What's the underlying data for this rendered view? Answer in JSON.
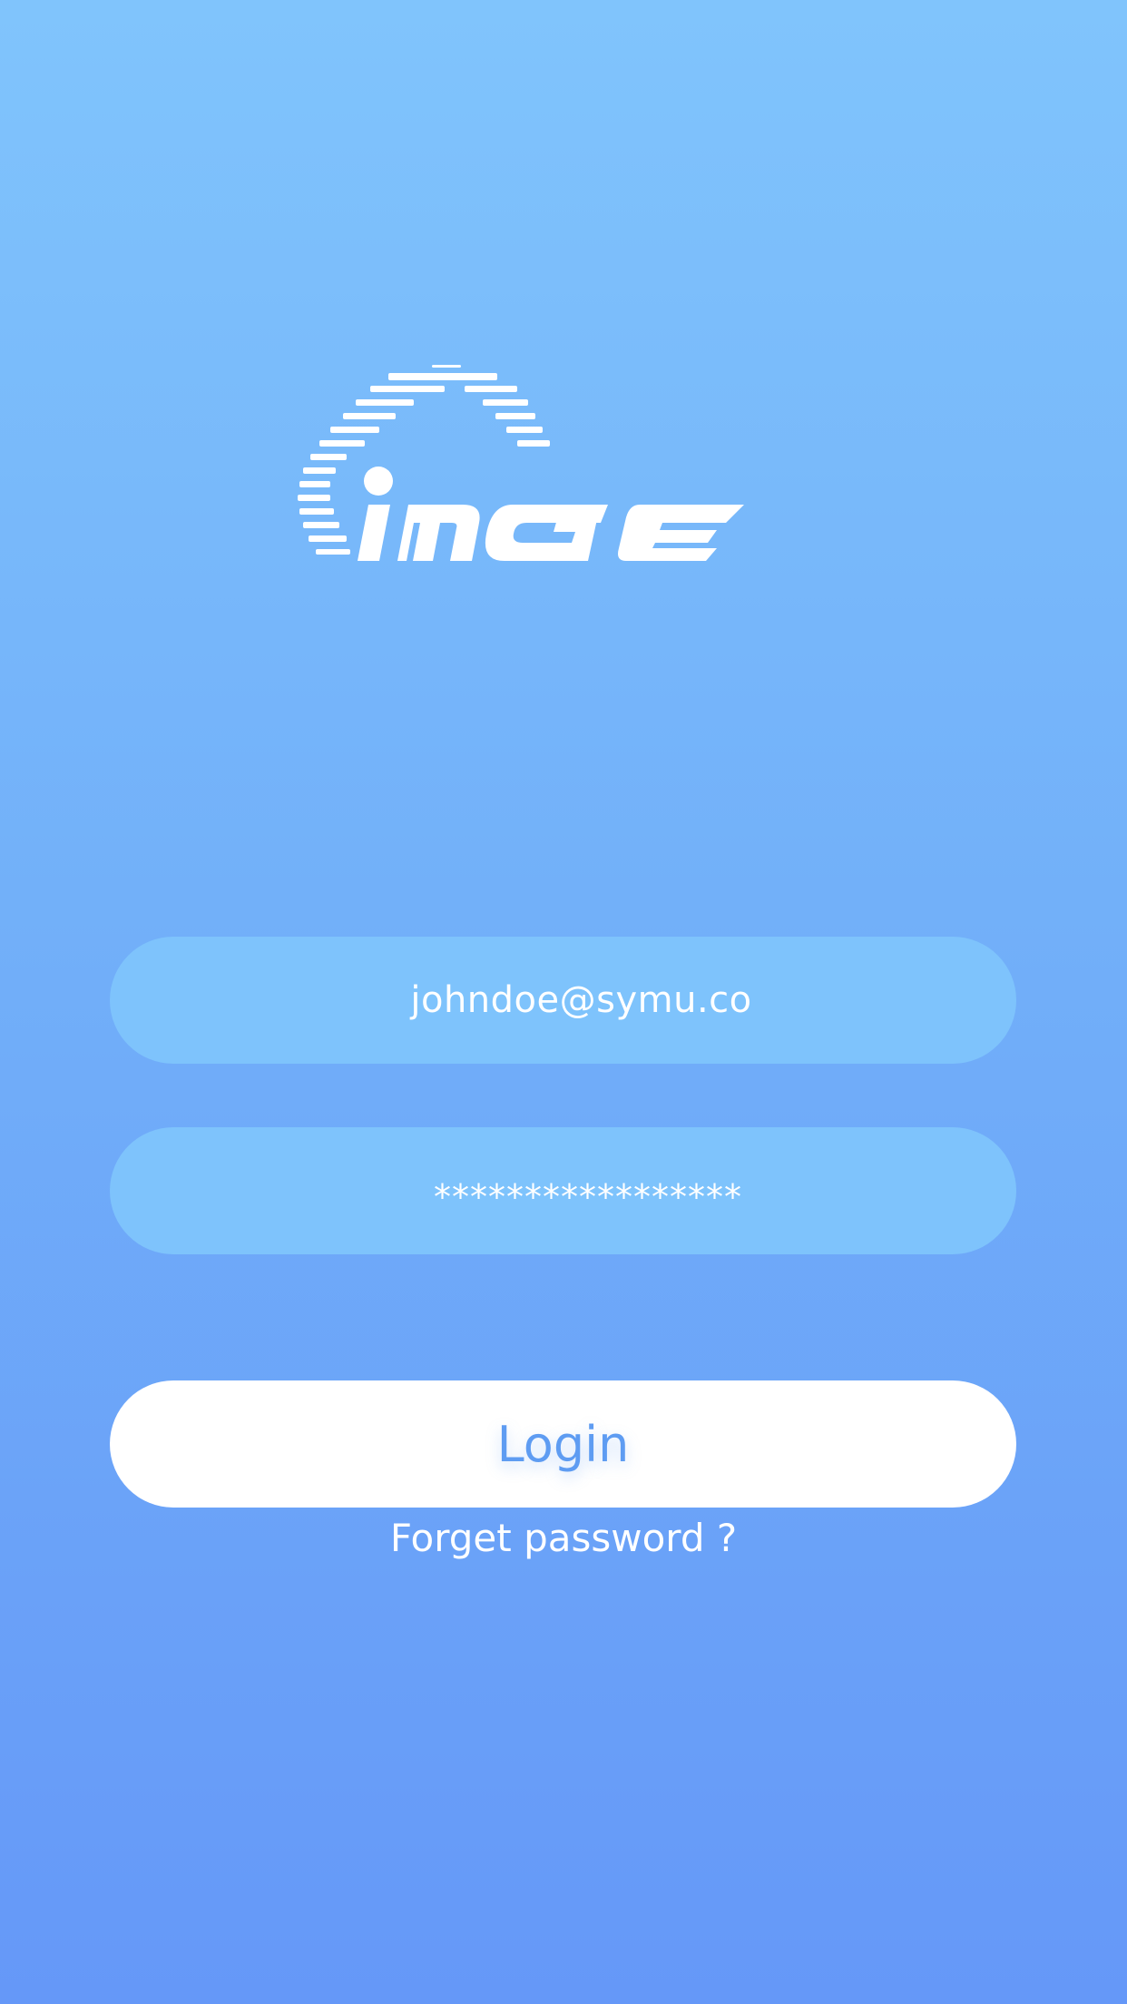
{
  "logo": {
    "text": "iMGE",
    "color": "#ffffff"
  },
  "login_form": {
    "email_value": "johndoe@symu.co",
    "password_value": "*****************",
    "login_label": "Login",
    "forgot_label": "Forget password ?"
  },
  "colors": {
    "gradient_top": "#80c4fc",
    "gradient_bottom": "#6598f8",
    "field_bg": "#7ec3fc",
    "button_bg": "#ffffff",
    "button_text": "#5e9cf2"
  }
}
